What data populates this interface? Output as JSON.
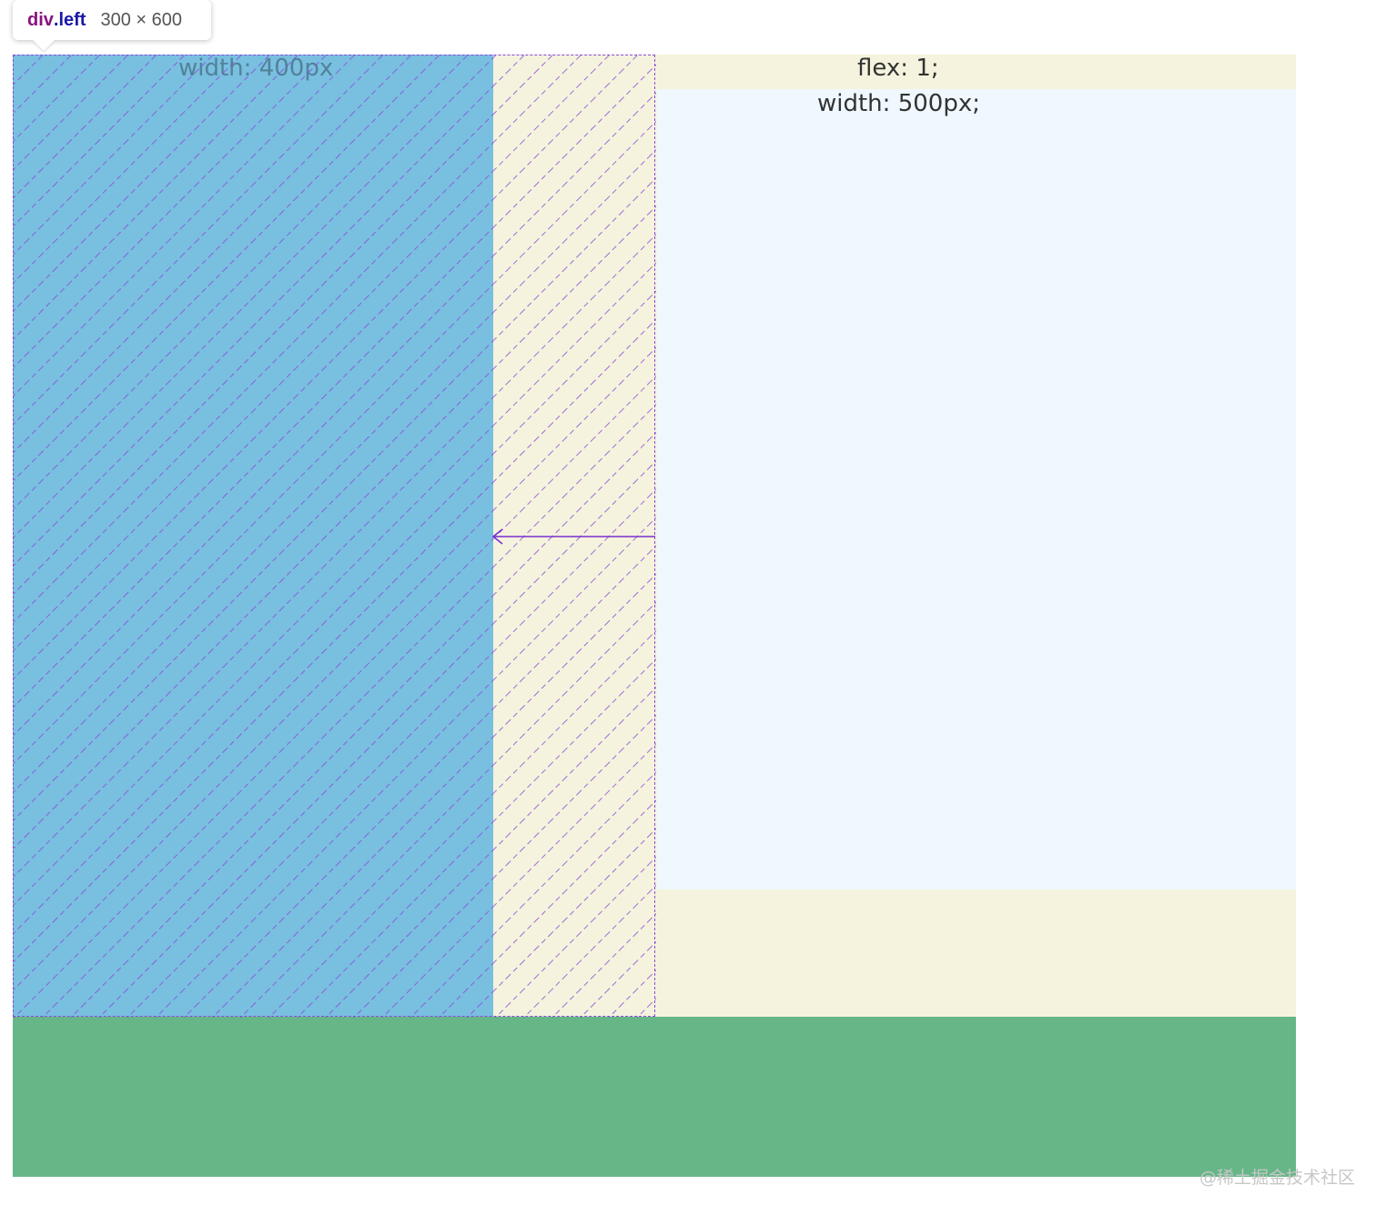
{
  "tooltip": {
    "tag": "div",
    "class": ".left",
    "size": "300 × 600"
  },
  "labels": {
    "left_width": "width: 400px",
    "right_flex": "flex: 1;",
    "right_width": "width: 500px;"
  },
  "watermark": "@稀土掘金技术社区",
  "colors": {
    "container_bg": "#f5f3dd",
    "left_bg": "#79bfe0",
    "right_bg": "#eff8fe",
    "footer_bg": "#66b687",
    "hatch": "#8a4bd8"
  }
}
